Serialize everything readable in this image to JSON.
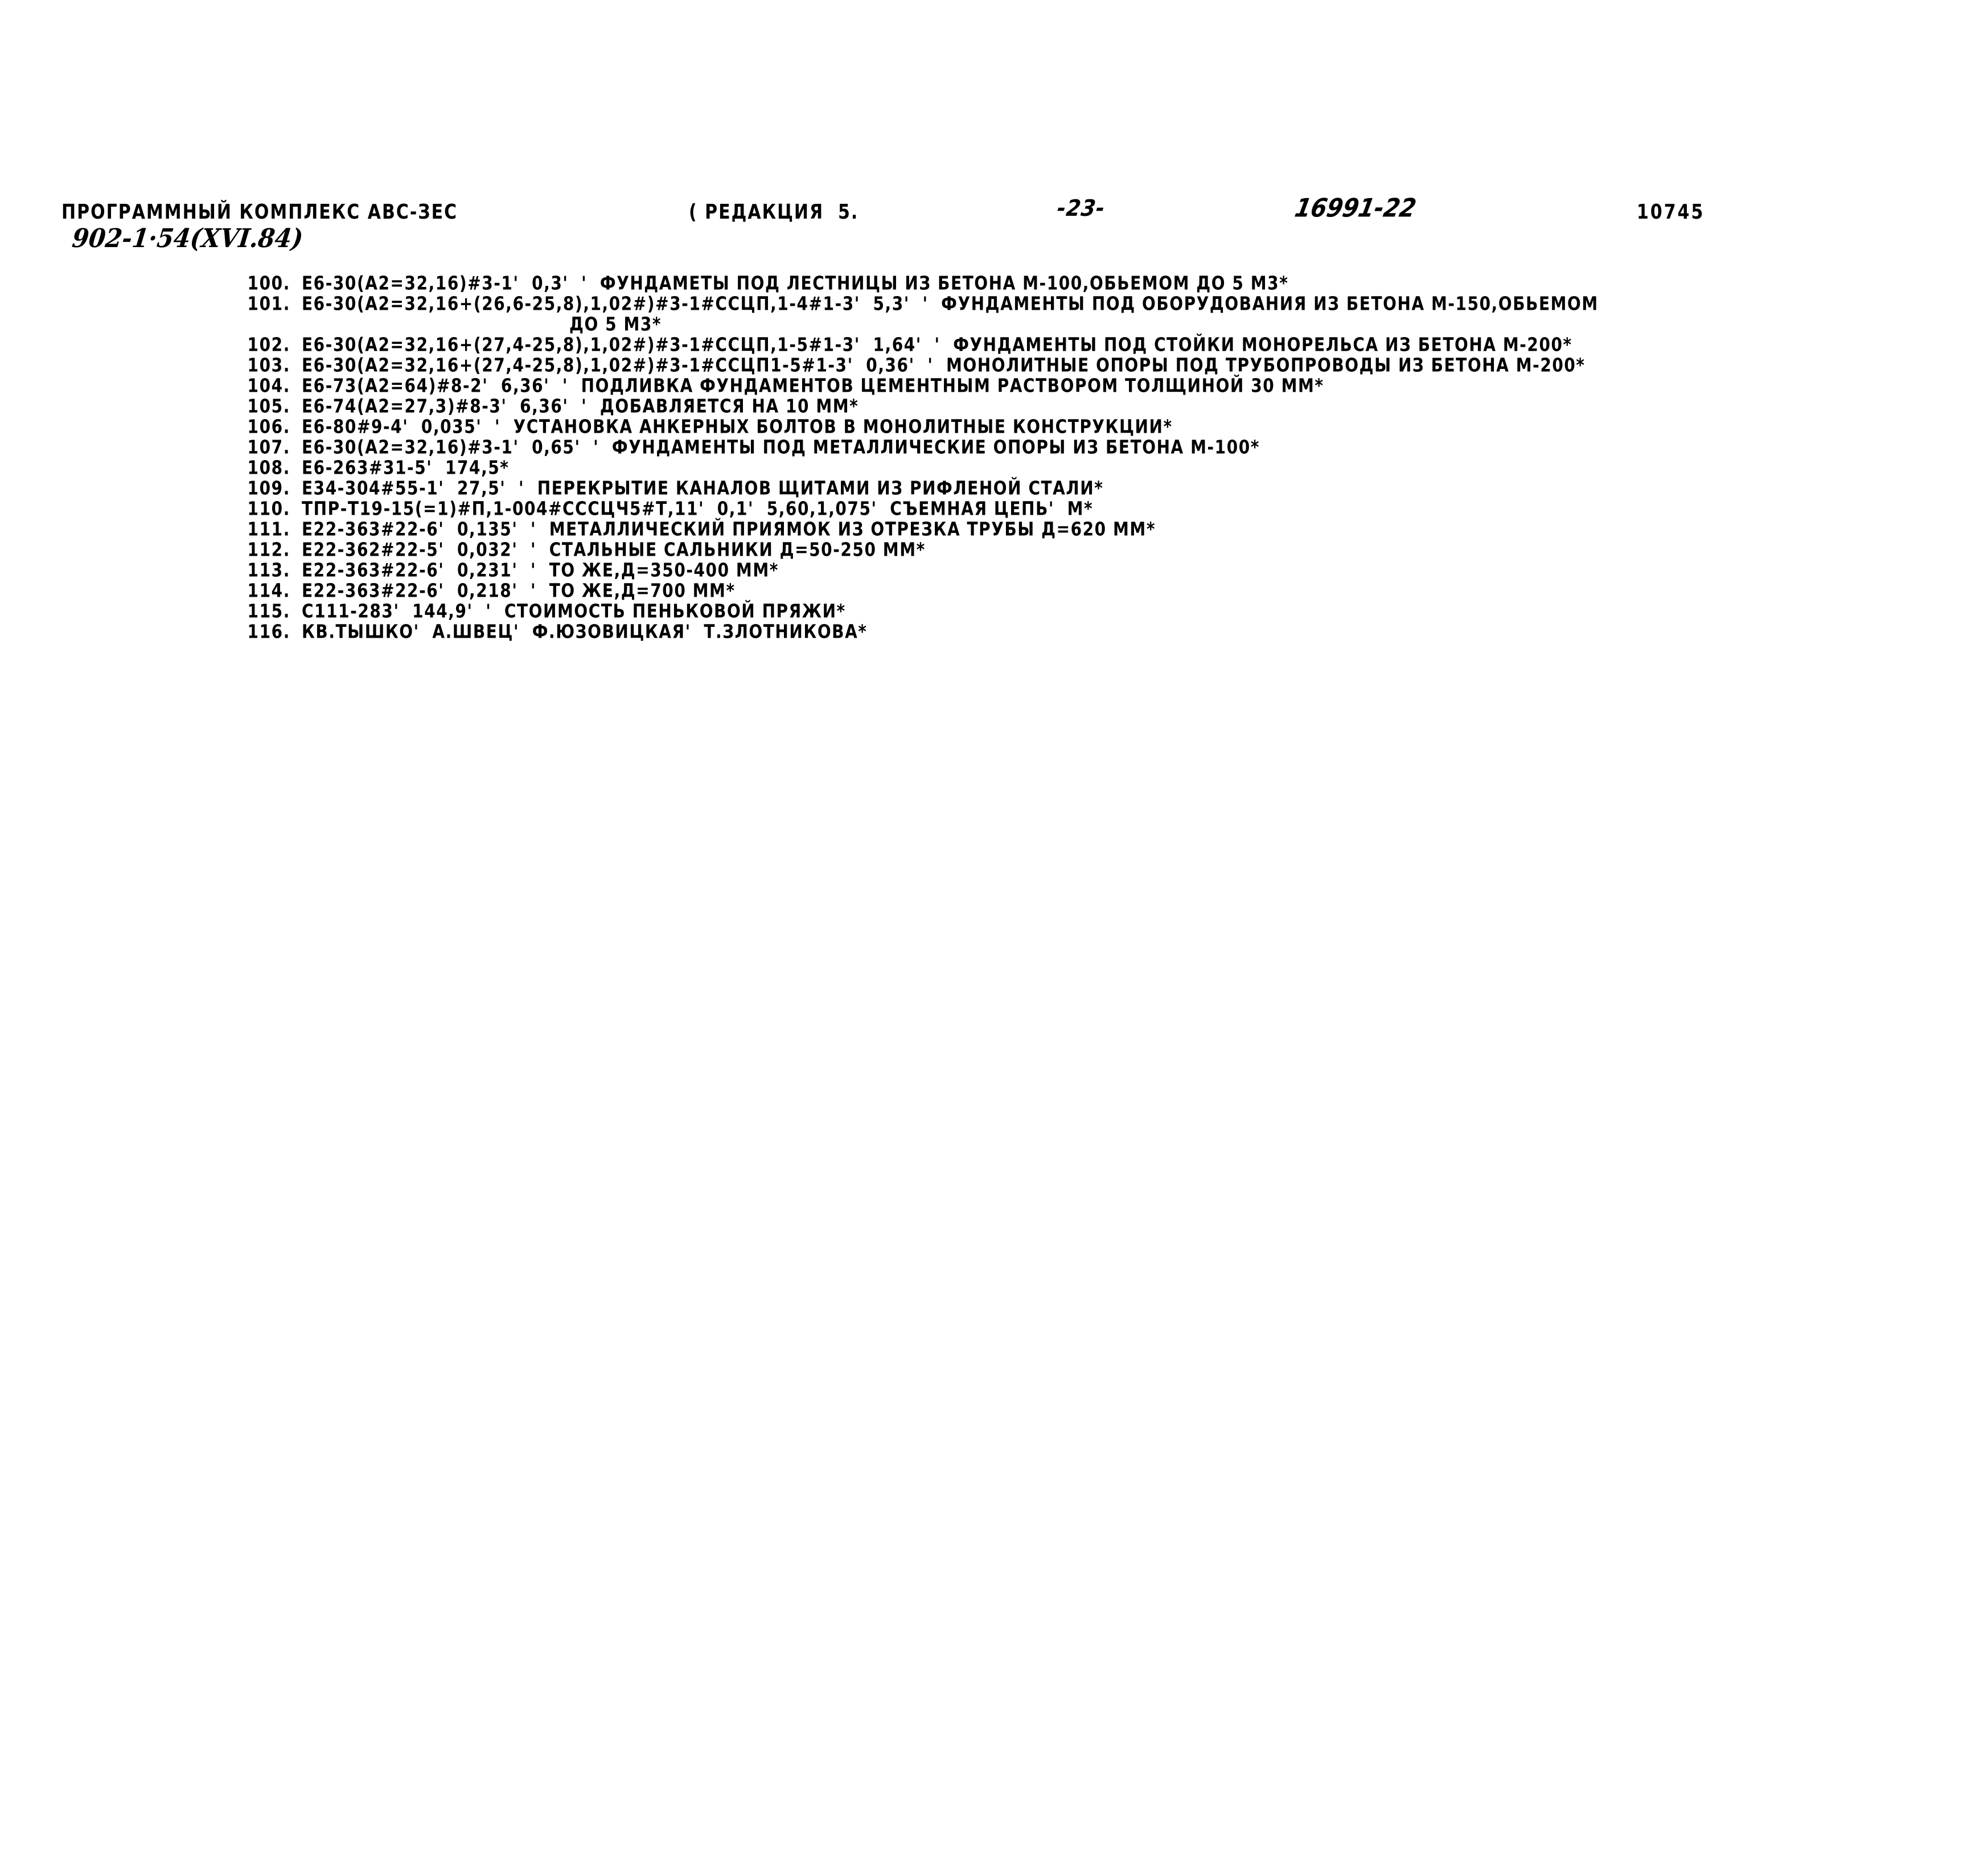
{
  "header": {
    "title": "ПРОГРАММНЫЙ КОМПЛЕКС АВС-ЗЕС",
    "edition": "( РЕДАКЦИЯ  5.",
    "page_number": "-23-",
    "hand_number": "16991-22",
    "doc_number": "10745",
    "album_code": "902-1·54(XVI.84)"
  },
  "listing": {
    "rows": [
      {
        "num": "100.",
        "text": "E6-30(A2=32,16)#3-1'  0,3'  '  ФУНДАМЕТЫ ПОД ЛЕСТНИЦЫ ИЗ БЕТОНА М-100,ОБЬЕМОМ ДО 5 М3*",
        "cont": false
      },
      {
        "num": "101.",
        "text": "E6-30(A2=32,16+(26,6-25,8),1,02#)#3-1#ССЦП,1-4#1-3'  5,3'  '  ФУНДАМЕНТЫ ПОД ОБОРУДОВАНИЯ ИЗ БЕТОНА М-150,ОБЬЕМОМ",
        "cont": false
      },
      {
        "num": "",
        "text": "ДО 5 М3*",
        "cont": true
      },
      {
        "num": "102.",
        "text": "E6-30(A2=32,16+(27,4-25,8),1,02#)#3-1#ССЦП,1-5#1-3'  1,64'  '  ФУНДАМЕНТЫ ПОД СТОЙКИ МОНОРЕЛЬСА ИЗ БЕТОНА М-200*",
        "cont": false
      },
      {
        "num": "103.",
        "text": "E6-30(A2=32,16+(27,4-25,8),1,02#)#3-1#ССЦП1-5#1-3'  0,36'  '  МОНОЛИТНЫЕ ОПОРЫ ПОД ТРУБОПРОВОДЫ ИЗ БЕТОНА М-200*",
        "cont": false
      },
      {
        "num": "104.",
        "text": "E6-73(A2=64)#8-2'  6,36'  '  ПОДЛИВКА ФУНДАМЕНТОВ ЦЕМЕНТНЫМ РАСТВОРОМ ТОЛЩИНОЙ 30 ММ*",
        "cont": false
      },
      {
        "num": "105.",
        "text": "E6-74(A2=27,3)#8-3'  6,36'  '  ДОБАВЛЯЕТСЯ НА 10 ММ*",
        "cont": false
      },
      {
        "num": "106.",
        "text": "E6-80#9-4'  0,035'  '  УСТАНОВКА АНКЕРНЫХ БОЛТОВ В МОНОЛИТНЫЕ КОНСТРУКЦИИ*",
        "cont": false
      },
      {
        "num": "107.",
        "text": "E6-30(A2=32,16)#3-1'  0,65'  '  ФУНДАМЕНТЫ ПОД МЕТАЛЛИЧЕСКИЕ ОПОРЫ ИЗ БЕТОНА М-100*",
        "cont": false
      },
      {
        "num": "108.",
        "text": "E6-263#31-5'  174,5*",
        "cont": false
      },
      {
        "num": "109.",
        "text": "E34-304#55-1'  27,5'  '  ПЕРЕКРЫТИЕ КАНАЛОВ ЩИТАМИ ИЗ РИФЛЕНОЙ СТАЛИ*",
        "cont": false
      },
      {
        "num": "110.",
        "text": "ТПР-Т19-15(=1)#П,1-004#ССCЦЧ5#Т,11'  0,1'  5,60,1,075'  СЪЕМНАЯ ЦЕПЬ'  М*",
        "cont": false
      },
      {
        "num": "111.",
        "text": "E22-363#22-6'  0,135'  '  МЕТАЛЛИЧЕСКИЙ ПРИЯМОК ИЗ ОТРЕЗКА ТРУБЫ Д=620 ММ*",
        "cont": false
      },
      {
        "num": "112.",
        "text": "E22-362#22-5'  0,032'  '  СТАЛЬНЫЕ САЛЬНИКИ Д=50-250 ММ*",
        "cont": false
      },
      {
        "num": "113.",
        "text": "E22-363#22-6'  0,231'  '  ТО ЖЕ,Д=350-400 ММ*",
        "cont": false
      },
      {
        "num": "114.",
        "text": "E22-363#22-6'  0,218'  '  ТО ЖЕ,Д=700 ММ*",
        "cont": false
      },
      {
        "num": "115.",
        "text": "С111-283'  144,9'  '  СТОИМОСТЬ ПЕНЬКОВОЙ ПРЯЖИ*",
        "cont": false
      },
      {
        "num": "116.",
        "text": "КВ.ТЫШКО'  А.ШВЕЦ'  Ф.ЮЗОВИЦКАЯ'  Т.ЗЛОТНИКОВА*",
        "cont": false
      }
    ]
  }
}
